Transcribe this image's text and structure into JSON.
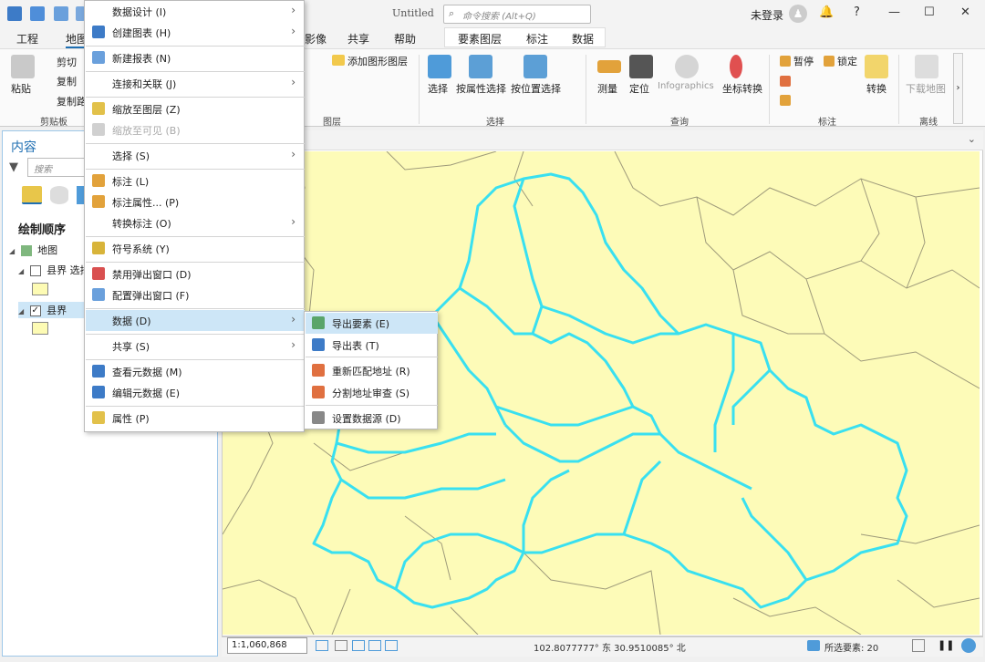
{
  "titlebar": {
    "doc_title": "Untitled",
    "command_search_placeholder": "命令搜索 (Alt+Q)",
    "login_label": "未登录",
    "avatar_glyph": "♟",
    "notification_glyph": "🔔",
    "help_glyph": "?",
    "minimize_glyph": "—",
    "maximize_glyph": "☐",
    "close_glyph": "✕"
  },
  "tabs": {
    "project": "工程",
    "map": "地图",
    "imagery": "影像",
    "share": "共享",
    "help": "帮助",
    "feature_layer": "要素图层",
    "labeling": "标注",
    "data": "数据"
  },
  "ribbon": {
    "paste": "粘贴",
    "cut": "剪切",
    "copy": "复制",
    "copy_path": "复制路",
    "clipboard_group": "剪贴板",
    "add_graphics_layer": "添加图形图层",
    "layer_group": "图层",
    "select": "选择",
    "select_by_attr": "按属性选择",
    "select_by_loc": "按位置选择",
    "selection_group": "选择",
    "measure": "测量",
    "locate": "定位",
    "infographics": "Infographics",
    "convert_coords": "坐标转换",
    "query_group": "查询",
    "pause": "暂停",
    "lock": "锁定",
    "labeling_group": "标注",
    "convert": "转换",
    "download_map": "下载地图",
    "offline_group": "离线"
  },
  "contents": {
    "title": "内容",
    "search_placeholder": "搜索",
    "drawing_order": "绘制顺序",
    "map_node": "地图",
    "layer1": "县界 选择",
    "layer2": "县界"
  },
  "context_menu": [
    {
      "label": "数据设计 (I)",
      "arrow": true,
      "icon": ""
    },
    {
      "label": "创建图表 (H)",
      "arrow": true,
      "icon": "chart"
    },
    {
      "label": "新建报表 (N)",
      "arrow": false,
      "icon": "report"
    },
    {
      "label": "连接和关联 (J)",
      "arrow": true,
      "icon": ""
    },
    {
      "label": "缩放至图层 (Z)",
      "arrow": false,
      "icon": "zoom"
    },
    {
      "label": "缩放至可见 (B)",
      "arrow": false,
      "icon": "zoomvis",
      "disabled": true
    },
    {
      "label": "选择 (S)",
      "arrow": true,
      "icon": ""
    },
    {
      "label": "标注 (L)",
      "arrow": false,
      "icon": "label"
    },
    {
      "label": "标注属性... (P)",
      "arrow": false,
      "icon": "labelprop"
    },
    {
      "label": "转换标注 (O)",
      "arrow": true,
      "icon": ""
    },
    {
      "label": "符号系统 (Y)",
      "arrow": false,
      "icon": "symbol"
    },
    {
      "label": "禁用弹出窗口 (D)",
      "arrow": false,
      "icon": "popupoff"
    },
    {
      "label": "配置弹出窗口 (F)",
      "arrow": false,
      "icon": "popupcfg"
    },
    {
      "label": "数据 (D)",
      "arrow": true,
      "icon": "",
      "active": true
    },
    {
      "label": "共享 (S)",
      "arrow": true,
      "icon": ""
    },
    {
      "label": "查看元数据 (M)",
      "arrow": false,
      "icon": "meta"
    },
    {
      "label": "编辑元数据 (E)",
      "arrow": false,
      "icon": "editmeta"
    },
    {
      "label": "属性 (P)",
      "arrow": false,
      "icon": "props"
    }
  ],
  "submenu": [
    {
      "label": "导出要素 (E)",
      "active": true
    },
    {
      "label": "导出表 (T)"
    },
    {
      "label": "重新匹配地址 (R)"
    },
    {
      "label": "分割地址审查 (S)"
    },
    {
      "label": "设置数据源 (D)"
    }
  ],
  "statusbar": {
    "scale": "1:1,060,868",
    "coordinates": "102.8077777° 东  30.9510085° 北",
    "selected_features": "所选要素: 20"
  },
  "colors": {
    "map_background": "#fdfbb8",
    "county_boundary": "#9e9a7a",
    "selected_outline": "#39e0f0",
    "menu_highlight": "#cde6f7"
  }
}
